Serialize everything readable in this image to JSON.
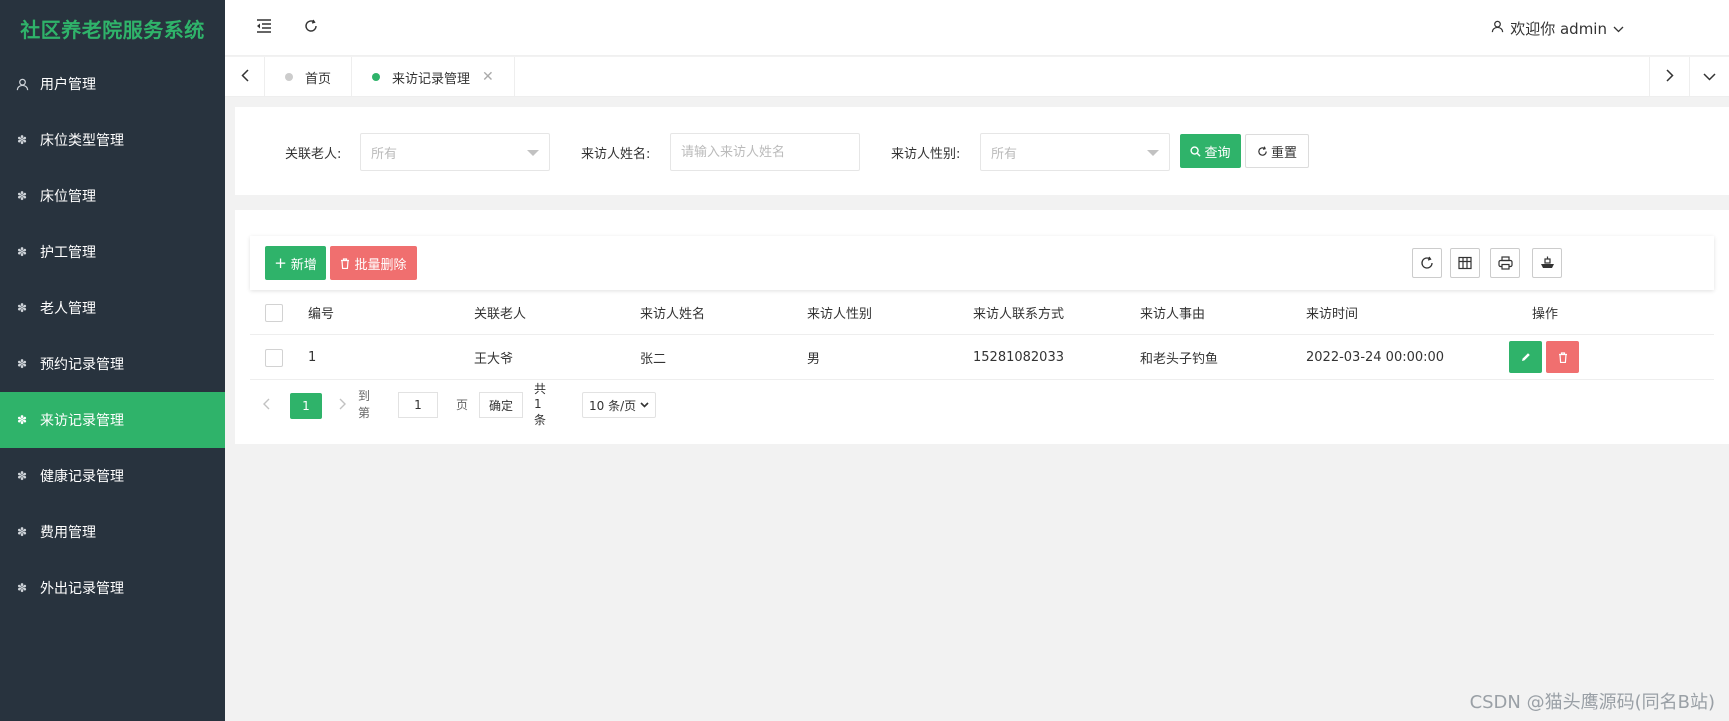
{
  "sidebar": {
    "logo": "社区养老院服务系统",
    "items": [
      {
        "label": "用户管理",
        "icon": "user-icon"
      },
      {
        "label": "床位类型管理",
        "icon": "gear-icon"
      },
      {
        "label": "床位管理",
        "icon": "gear-icon"
      },
      {
        "label": "护工管理",
        "icon": "gear-icon"
      },
      {
        "label": "老人管理",
        "icon": "gear-icon"
      },
      {
        "label": "预约记录管理",
        "icon": "gear-icon"
      },
      {
        "label": "来访记录管理",
        "icon": "gear-icon",
        "active": true
      },
      {
        "label": "健康记录管理",
        "icon": "gear-icon"
      },
      {
        "label": "费用管理",
        "icon": "gear-icon"
      },
      {
        "label": "外出记录管理",
        "icon": "gear-icon"
      }
    ]
  },
  "header": {
    "user_label": "欢迎你 admin"
  },
  "tabs": {
    "items": [
      {
        "label": "首页"
      },
      {
        "label": "来访记录管理",
        "active": true
      }
    ]
  },
  "search": {
    "elder_label": "关联老人:",
    "elder_value": "所有",
    "name_label": "来访人姓名:",
    "name_placeholder": "请输入来访人姓名",
    "gender_label": "来访人性别:",
    "gender_value": "所有",
    "query_label": "查询",
    "reset_label": "重置"
  },
  "toolbar": {
    "add_label": "新增",
    "batch_delete_label": "批量删除"
  },
  "table": {
    "columns": [
      "编号",
      "关联老人",
      "来访人姓名",
      "来访人性别",
      "来访人联系方式",
      "来访人事由",
      "来访时间",
      "操作"
    ],
    "rows": [
      [
        "1",
        "王大爷",
        "张二",
        "男",
        "15281082033",
        "和老头子钓鱼",
        "2022-03-24 00:00:00"
      ]
    ]
  },
  "pagination": {
    "current": "1",
    "goto_label": "到第",
    "goto_value": "1",
    "page_label": "页",
    "confirm_label": "确定",
    "total_label": "共 1 条",
    "page_size": "10 条/页"
  },
  "watermark": "CSDN @猫头鹰源码(同名B站)",
  "colors": {
    "brand": "#2fb36a",
    "danger": "#f06f6f",
    "sidebar_bg": "#28333e"
  }
}
